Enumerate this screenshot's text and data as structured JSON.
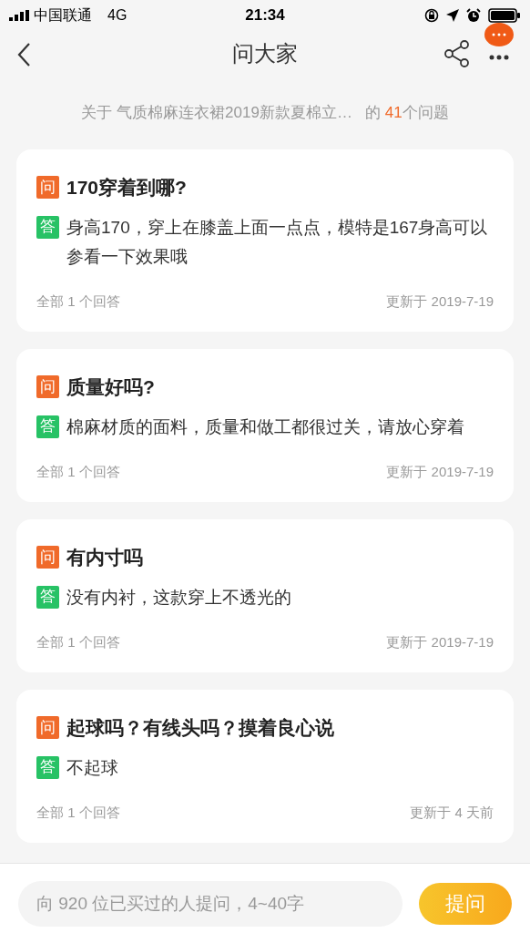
{
  "status_bar": {
    "carrier": "中国联通",
    "network": "4G",
    "time": "21:34"
  },
  "header": {
    "title": "问大家"
  },
  "summary": {
    "prefix": "关于 气质棉麻连衣裙2019新款夏棉立…",
    "middle": "的",
    "count": "41",
    "suffix": "个问题"
  },
  "questions": [
    {
      "q_badge": "问",
      "question": "170穿着到哪?",
      "a_badge": "答",
      "answer": "身高170，穿上在膝盖上面一点点，模特是167身高可以参看一下效果哦",
      "answer_count": "全部 1 个回答",
      "updated": "更新于 2019-7-19"
    },
    {
      "q_badge": "问",
      "question": "质量好吗?",
      "a_badge": "答",
      "answer": "棉麻材质的面料，质量和做工都很过关，请放心穿着",
      "answer_count": "全部 1 个回答",
      "updated": "更新于 2019-7-19"
    },
    {
      "q_badge": "问",
      "question": "有内寸吗",
      "a_badge": "答",
      "answer": "没有内衬，这款穿上不透光的",
      "answer_count": "全部 1 个回答",
      "updated": "更新于 2019-7-19"
    },
    {
      "q_badge": "问",
      "question": "起球吗？有线头吗？摸着良心说",
      "a_badge": "答",
      "answer": "不起球",
      "answer_count": "全部 1 个回答",
      "updated": "更新于 4 天前"
    }
  ],
  "ask_bar": {
    "placeholder": "向 920 位已买过的人提问，4~40字",
    "button": "提问"
  }
}
